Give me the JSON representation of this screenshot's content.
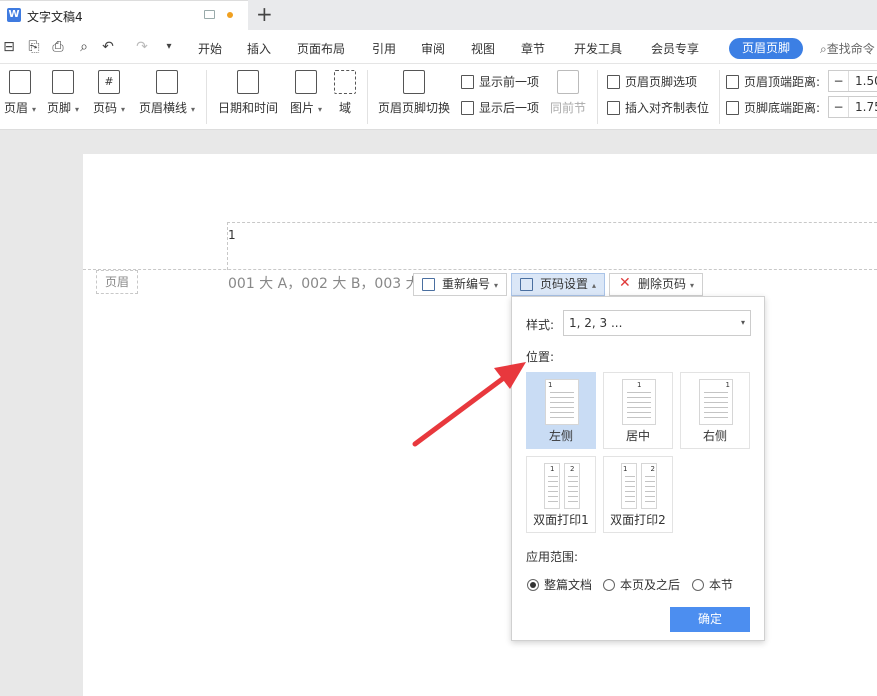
{
  "window": {
    "tab_title": "文字文稿4",
    "app_logo_letter": "W"
  },
  "menu": {
    "items": [
      "开始",
      "插入",
      "页面布局",
      "引用",
      "审阅",
      "视图",
      "章节",
      "开发工具",
      "会员专享"
    ],
    "active": "页眉页脚",
    "search": "查找命令"
  },
  "ribbon": {
    "header": "页眉",
    "footer": "页脚",
    "page_number": "页码",
    "header_line": "页眉横线",
    "datetime": "日期和时间",
    "picture": "图片",
    "field": "域",
    "switch": "页眉页脚切换",
    "show_prev": "显示前一项",
    "show_next": "显示后一项",
    "same_as_prev": "同前节",
    "hf_options": "页眉页脚选项",
    "insert_tab": "插入对齐制表位",
    "header_top_dist_label": "页眉顶端距离:",
    "header_top_dist_value": "1.50",
    "footer_bottom_dist_label": "页脚底端距离:",
    "footer_bottom_dist_value": "1.75"
  },
  "document": {
    "header_number": "1",
    "header_tag": "页眉",
    "header_text": "001 大 A，002 大 B，003 大"
  },
  "page_number_toolbar": {
    "renumber": "重新编号",
    "settings": "页码设置",
    "delete": "删除页码"
  },
  "popup": {
    "style_label": "样式:",
    "style_value": "1, 2, 3 ...",
    "position_label": "位置:",
    "positions": [
      {
        "label": "左侧",
        "selected": true
      },
      {
        "label": "居中",
        "selected": false
      },
      {
        "label": "右侧",
        "selected": false
      },
      {
        "label": "双面打印1",
        "selected": false
      },
      {
        "label": "双面打印2",
        "selected": false
      }
    ],
    "sample_digit_1": "1",
    "sample_digit_2": "2",
    "scope_label": "应用范围:",
    "scope_options": [
      {
        "label": "整篇文档",
        "checked": true
      },
      {
        "label": "本页及之后",
        "checked": false
      },
      {
        "label": "本节",
        "checked": false
      }
    ],
    "ok": "确定"
  },
  "colors": {
    "accent": "#3c7fe4",
    "ok_button": "#4c8ef0",
    "selected_option": "#c9dcf4",
    "arrow": "#e8383d"
  }
}
